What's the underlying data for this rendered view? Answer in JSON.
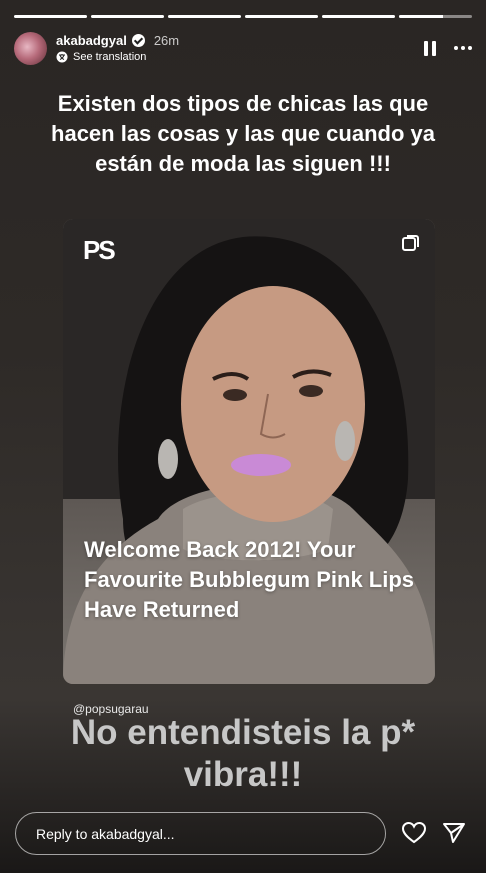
{
  "story": {
    "progress": [
      1,
      1,
      1,
      1,
      1,
      0.6
    ]
  },
  "header": {
    "username": "akabadgyal",
    "time": "26m",
    "translation_label": "See translation",
    "pause_icon": "pause-icon",
    "more_icon": "more-icon"
  },
  "caption": "Existen dos tipos de chicas las que hacen las cosas y las que cuando ya están de moda las siguen !!!",
  "card": {
    "logo": "PS",
    "headline": "Welcome Back 2012! Your Favourite Bubblegum Pink Lips Have Returned",
    "multi_icon": "carousel-icon"
  },
  "mention": "@popsugarau",
  "bottom_text": "No entendisteis la p* vibra!!!",
  "reply": {
    "placeholder": "Reply to akabadgyal...",
    "heart_icon": "heart-icon",
    "send_icon": "send-icon"
  },
  "colors": {
    "lipstick": "#c98ad6",
    "background": "#2e2a27"
  }
}
